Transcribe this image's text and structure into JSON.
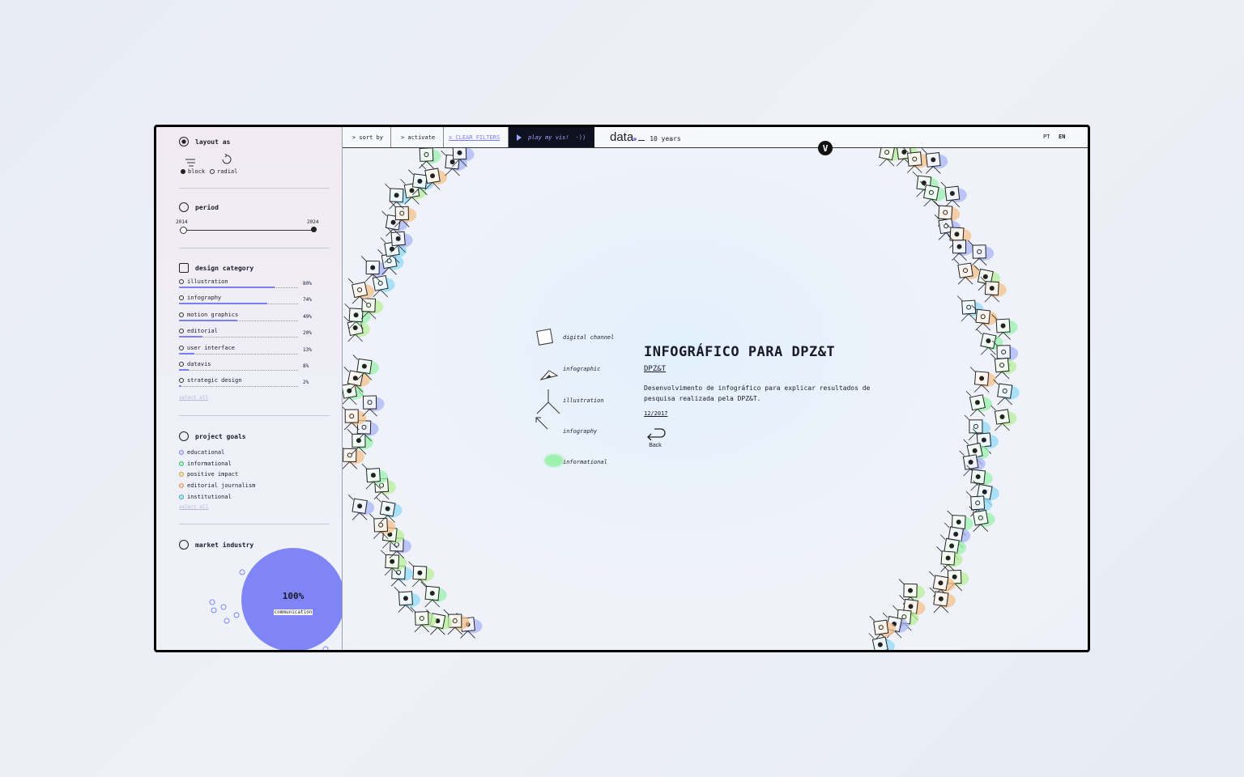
{
  "sidebar": {
    "layout": {
      "title": "layout as",
      "options": [
        "block",
        "radial"
      ]
    },
    "period": {
      "title": "period",
      "start": "2014",
      "end": "2024",
      "range": [
        2014,
        2024
      ]
    },
    "category": {
      "title": "design category",
      "items": [
        {
          "label": "illustration",
          "pct": "80%",
          "v": 0.8
        },
        {
          "label": "infography",
          "pct": "74%",
          "v": 0.74
        },
        {
          "label": "motion graphics",
          "pct": "49%",
          "v": 0.49
        },
        {
          "label": "editorial",
          "pct": "20%",
          "v": 0.2
        },
        {
          "label": "user interface",
          "pct": "13%",
          "v": 0.13
        },
        {
          "label": "datavis",
          "pct": "8%",
          "v": 0.08
        },
        {
          "label": "strategic design",
          "pct": "2%",
          "v": 0.02
        }
      ],
      "select_all": "select all"
    },
    "goals": {
      "title": "project goals",
      "items": [
        {
          "label": "educational",
          "color": "#7a80f0"
        },
        {
          "label": "informational",
          "color": "#3cb96a"
        },
        {
          "label": "positive impact",
          "color": "#d6a23a"
        },
        {
          "label": "editorial journalism",
          "color": "#e08a4a"
        },
        {
          "label": "institutional",
          "color": "#3aa6b8"
        }
      ],
      "select_all": "select all"
    },
    "industry": {
      "title": "market industry",
      "value": "100%",
      "label": "communication",
      "color": "#7f85f5"
    }
  },
  "topbar": {
    "sort": "> sort by",
    "activate": "> activate",
    "clear": "x CLEAR FILTERS",
    "play": "play my vis!",
    "logo": "data",
    "logo_sub": "10 years",
    "lang_pt": "PT",
    "lang_en": "EN",
    "circle_letter": "V"
  },
  "legend": [
    "digital channel",
    "infographic",
    "illustration",
    "infography",
    "informational"
  ],
  "detail": {
    "title": "INFOGRÁFICO PARA DPZ&T",
    "client": "DPZ&T",
    "desc": "Desenvolvimento de infográfico para explicar resultados de pesquisa realizada pela DPZ&T.",
    "date": "12/2017",
    "back": "Back"
  }
}
